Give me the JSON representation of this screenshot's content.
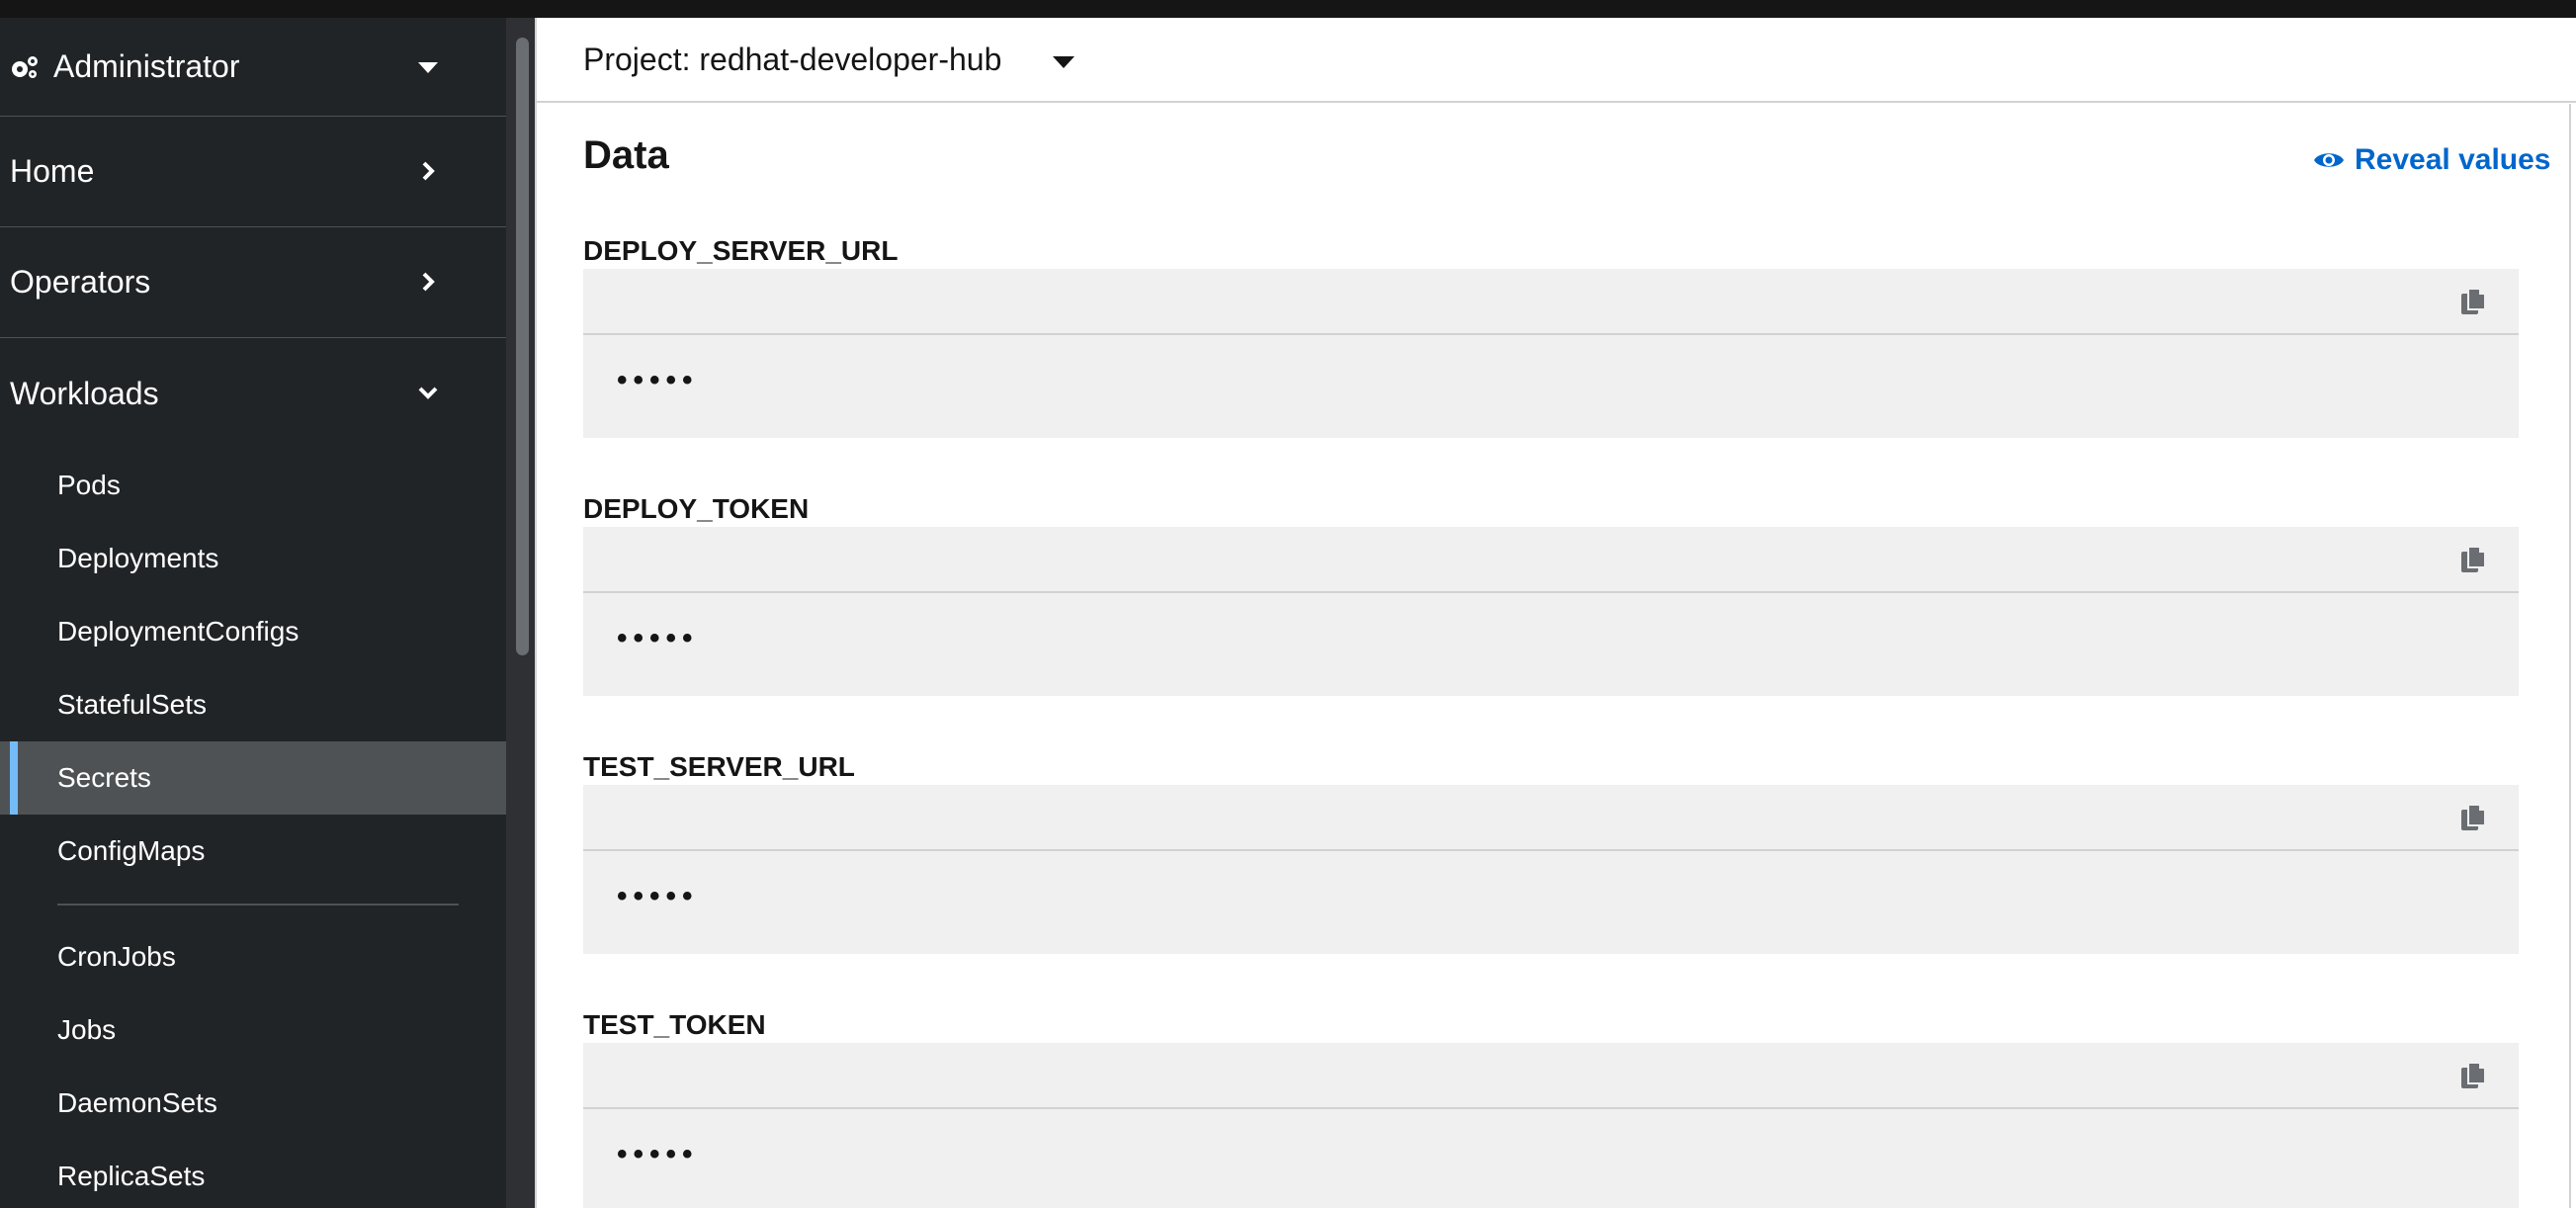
{
  "sidebar": {
    "perspective": "Administrator",
    "sections": [
      {
        "label": "Home"
      },
      {
        "label": "Operators"
      },
      {
        "label": "Workloads"
      }
    ],
    "workloads_items": [
      "Pods",
      "Deployments",
      "DeploymentConfigs",
      "StatefulSets",
      "Secrets",
      "ConfigMaps"
    ],
    "workloads_items_2": [
      "CronJobs",
      "Jobs",
      "DaemonSets",
      "ReplicaSets"
    ],
    "active_item": "Secrets"
  },
  "header": {
    "project": "Project: redhat-developer-hub"
  },
  "main": {
    "section_title": "Data",
    "reveal_label": "Reveal values",
    "entries": [
      {
        "key": "DEPLOY_SERVER_URL",
        "value": "•••••"
      },
      {
        "key": "DEPLOY_TOKEN",
        "value": "•••••"
      },
      {
        "key": "TEST_SERVER_URL",
        "value": "•••••"
      },
      {
        "key": "TEST_TOKEN",
        "value": "•••••"
      }
    ]
  },
  "colors": {
    "sidebar_bg": "#212427",
    "active_bg": "#4f5255",
    "active_accent": "#73bcf7",
    "link": "#0066cc",
    "value_bg": "#f0f0f0"
  }
}
